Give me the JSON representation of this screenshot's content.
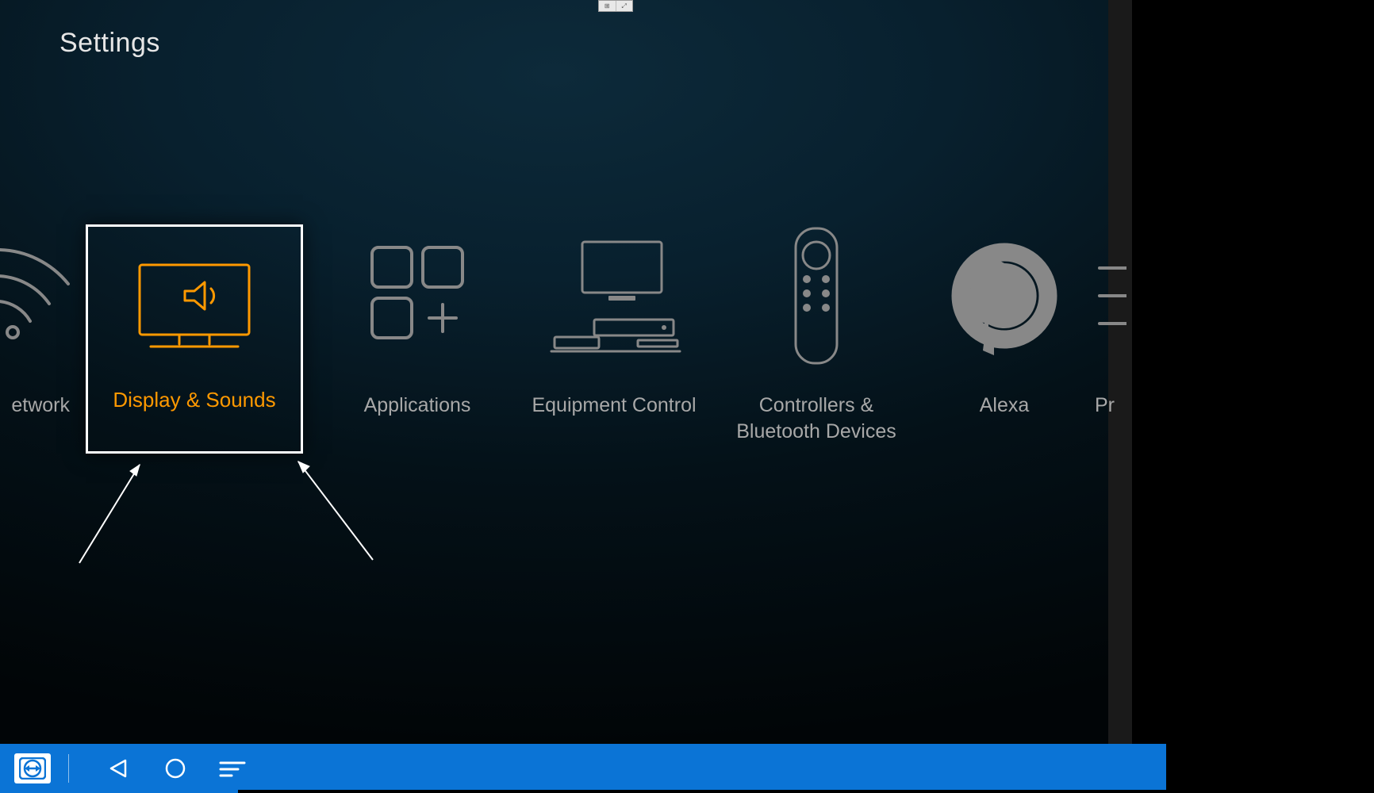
{
  "page": {
    "title": "Settings"
  },
  "tiles": {
    "network": {
      "label": "etwork",
      "full_label": "Network"
    },
    "display_sounds": {
      "label": "Display & Sounds",
      "selected": true
    },
    "applications": {
      "label": "Applications"
    },
    "equipment_control": {
      "label": "Equipment Control"
    },
    "controllers_bluetooth": {
      "label": "Controllers & Bluetooth Devices"
    },
    "alexa": {
      "label": "Alexa"
    },
    "preferences_partial": {
      "label": "Pr"
    }
  },
  "navbar": {
    "app": "TeamViewer",
    "buttons": {
      "back": "Back",
      "home": "Home",
      "recents": "Recents"
    }
  },
  "colors": {
    "accent": "#ff9900",
    "nav_bg": "#0b74d6",
    "text_muted": "#a8a8a8"
  }
}
